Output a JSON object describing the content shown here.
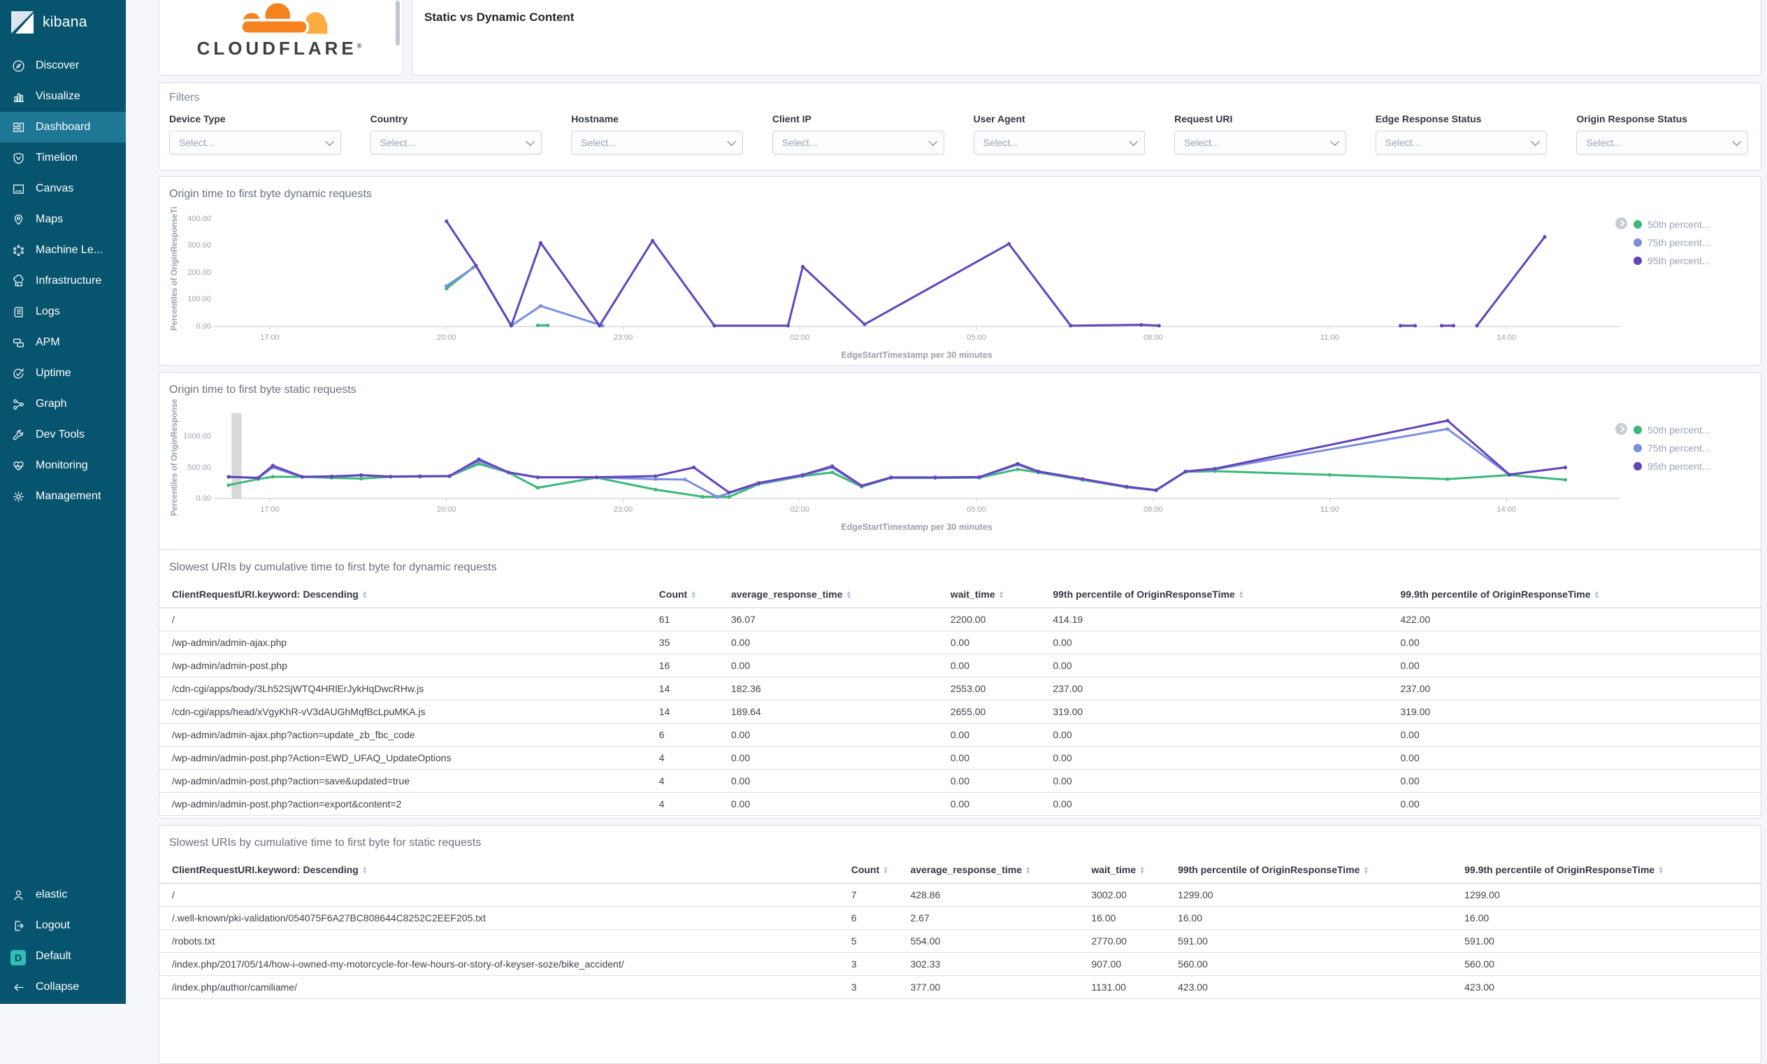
{
  "sidebar": {
    "logo_text": "kibana",
    "items": [
      {
        "icon": "discover",
        "label": "Discover",
        "active": false
      },
      {
        "icon": "visualize",
        "label": "Visualize",
        "active": false
      },
      {
        "icon": "dashboard",
        "label": "Dashboard",
        "active": true
      },
      {
        "icon": "timelion",
        "label": "Timelion",
        "active": false
      },
      {
        "icon": "canvas",
        "label": "Canvas",
        "active": false
      },
      {
        "icon": "maps",
        "label": "Maps",
        "active": false
      },
      {
        "icon": "machine-learning",
        "label": "Machine Le...",
        "active": false
      },
      {
        "icon": "infrastructure",
        "label": "Infrastructure",
        "active": false
      },
      {
        "icon": "logs",
        "label": "Logs",
        "active": false
      },
      {
        "icon": "apm",
        "label": "APM",
        "active": false
      },
      {
        "icon": "uptime",
        "label": "Uptime",
        "active": false
      },
      {
        "icon": "graph",
        "label": "Graph",
        "active": false
      },
      {
        "icon": "dev-tools",
        "label": "Dev Tools",
        "active": false
      },
      {
        "icon": "monitoring",
        "label": "Monitoring",
        "active": false
      },
      {
        "icon": "management",
        "label": "Management",
        "active": false
      }
    ],
    "footer_items": [
      {
        "icon": "user",
        "label": "elastic"
      },
      {
        "icon": "logout",
        "label": "Logout"
      },
      {
        "icon": "default-space",
        "label": "Default",
        "badge": "D"
      },
      {
        "icon": "collapse",
        "label": "Collapse"
      }
    ]
  },
  "header": {
    "dashboard_title": "Static vs Dynamic Content",
    "brand": "CLOUDFLARE"
  },
  "filters": {
    "panel_title": "Filters",
    "select_placeholder": "Select...",
    "fields": [
      "Device Type",
      "Country",
      "Hostname",
      "Client IP",
      "User Agent",
      "Request URI",
      "Edge Response Status",
      "Origin Response Status"
    ]
  },
  "chart_data": [
    {
      "type": "line",
      "title": "Origin time to first byte dynamic requests",
      "ylabel": "Percentiles of OriginResponseTi",
      "xlabel": "EdgeStartTimestamp per 30 minutes",
      "xlim": [
        16.05,
        39.92
      ],
      "ylim": [
        0,
        430
      ],
      "yticks": [
        0,
        100,
        200,
        300,
        400
      ],
      "ytick_labels": [
        "0.00",
        "100.00",
        "200.00",
        "300.00",
        "400.00"
      ],
      "xticks": [
        17,
        20,
        23,
        26,
        29,
        32,
        35,
        38
      ],
      "xtick_labels": [
        "17:00",
        "20:00",
        "23:00",
        "02:00",
        "05:00",
        "08:00",
        "11:00",
        "14:00"
      ],
      "legend_position": "right",
      "grid": false,
      "series": [
        {
          "name": "50th percent...",
          "color": "#3cb879",
          "segments": [
            [
              [
                20.0,
                140
              ],
              [
                20.45,
                218
              ]
            ],
            [
              [
                21.55,
                4
              ],
              [
                21.72,
                4
              ]
            ]
          ]
        },
        {
          "name": "75th percent...",
          "color": "#7b8fde",
          "segments": [
            [
              [
                20.0,
                150
              ],
              [
                20.5,
                224
              ],
              [
                21.1,
                3
              ],
              [
                21.6,
                76
              ],
              [
                22.65,
                3
              ]
            ]
          ]
        },
        {
          "name": "95th percent...",
          "color": "#6244bb",
          "segments": [
            [
              [
                20.0,
                390
              ],
              [
                20.5,
                226
              ],
              [
                21.1,
                3
              ],
              [
                21.6,
                310
              ],
              [
                22.6,
                3
              ],
              [
                23.5,
                318
              ],
              [
                24.55,
                3
              ],
              [
                25.8,
                3
              ],
              [
                26.05,
                222
              ],
              [
                27.1,
                8
              ],
              [
                29.55,
                306
              ],
              [
                30.6,
                3
              ],
              [
                31.8,
                6
              ],
              [
                32.1,
                3
              ]
            ],
            [
              [
                36.2,
                3
              ],
              [
                36.45,
                3
              ]
            ],
            [
              [
                36.9,
                3
              ],
              [
                37.1,
                3
              ]
            ],
            [
              [
                37.5,
                3
              ],
              [
                38.65,
                332
              ]
            ]
          ]
        }
      ]
    },
    {
      "type": "line",
      "title": "Origin time to first byte static requests",
      "ylabel": "Percentiles of OriginResponse",
      "xlabel": "EdgeStartTimestamp per 30 minutes",
      "xlim": [
        16.05,
        39.92
      ],
      "ylim": [
        0,
        1330
      ],
      "yticks": [
        0,
        500,
        1000
      ],
      "ytick_labels": [
        "0.00",
        "500.00",
        "1000.00"
      ],
      "xticks": [
        17,
        20,
        23,
        26,
        29,
        32,
        35,
        38
      ],
      "xtick_labels": [
        "17:00",
        "20:00",
        "23:00",
        "02:00",
        "05:00",
        "08:00",
        "11:00",
        "14:00"
      ],
      "legend_position": "right",
      "grid": false,
      "annotation_bar": {
        "t": 16.35,
        "width_hours": 0.17,
        "color": "#d8d8d8"
      },
      "series": [
        {
          "name": "50th percent...",
          "color": "#3cb879",
          "segments": [
            [
              [
                16.3,
                215
              ],
              [
                16.8,
                312
              ],
              [
                17.05,
                350
              ],
              [
                17.55,
                348
              ],
              [
                18.05,
                332
              ],
              [
                18.55,
                320
              ],
              [
                19.05,
                350
              ],
              [
                19.55,
                353
              ],
              [
                20.05,
                358
              ],
              [
                20.55,
                556
              ],
              [
                21.05,
                420
              ],
              [
                21.55,
                172
              ],
              [
                22.55,
                336
              ],
              [
                23.55,
                142
              ],
              [
                24.35,
                28
              ],
              [
                24.8,
                25
              ],
              [
                25.3,
                230
              ],
              [
                26.05,
                360
              ],
              [
                26.55,
                420
              ],
              [
                27.05,
                190
              ],
              [
                27.55,
                330
              ],
              [
                28.3,
                330
              ],
              [
                29.05,
                335
              ],
              [
                29.7,
                470
              ],
              [
                30.05,
                420
              ],
              [
                30.8,
                300
              ],
              [
                31.55,
                180
              ],
              [
                32.05,
                130
              ],
              [
                32.55,
                430
              ],
              [
                33.05,
                440
              ],
              [
                35.0,
                380
              ],
              [
                37.0,
                312
              ],
              [
                38.05,
                378
              ],
              [
                39.0,
                302
              ]
            ]
          ]
        },
        {
          "name": "75th percent...",
          "color": "#7b8fde",
          "segments": [
            [
              [
                16.3,
                345
              ],
              [
                16.8,
                330
              ],
              [
                17.05,
                500
              ],
              [
                17.55,
                346
              ],
              [
                18.05,
                352
              ],
              [
                18.55,
                372
              ],
              [
                19.05,
                352
              ],
              [
                19.55,
                357
              ],
              [
                20.05,
                360
              ],
              [
                20.55,
                600
              ],
              [
                21.05,
                418
              ],
              [
                21.55,
                338
              ],
              [
                22.55,
                338
              ],
              [
                23.55,
                312
              ],
              [
                24.05,
                305
              ],
              [
                24.6,
                25
              ],
              [
                25.3,
                240
              ],
              [
                26.05,
                370
              ],
              [
                26.55,
                500
              ],
              [
                27.05,
                200
              ],
              [
                27.55,
                335
              ],
              [
                28.3,
                335
              ],
              [
                29.05,
                340
              ],
              [
                29.7,
                545
              ],
              [
                30.05,
                430
              ],
              [
                30.8,
                310
              ],
              [
                31.55,
                185
              ],
              [
                32.05,
                132
              ],
              [
                32.55,
                432
              ],
              [
                33.05,
                470
              ],
              [
                37.0,
                1120
              ],
              [
                38.05,
                380
              ]
            ]
          ]
        },
        {
          "name": "95th percent...",
          "color": "#6244bb",
          "segments": [
            [
              [
                16.3,
                350
              ],
              [
                16.8,
                332
              ],
              [
                17.05,
                530
              ],
              [
                17.55,
                350
              ],
              [
                18.05,
                356
              ],
              [
                18.55,
                376
              ],
              [
                19.05,
                353
              ],
              [
                19.55,
                358
              ],
              [
                20.05,
                362
              ],
              [
                20.55,
                632
              ],
              [
                21.05,
                422
              ],
              [
                21.55,
                342
              ],
              [
                22.55,
                342
              ],
              [
                23.55,
                360
              ],
              [
                24.2,
                500
              ],
              [
                24.8,
                95
              ],
              [
                25.3,
                250
              ],
              [
                26.05,
                380
              ],
              [
                26.55,
                520
              ],
              [
                27.05,
                205
              ],
              [
                27.55,
                340
              ],
              [
                28.3,
                340
              ],
              [
                29.05,
                345
              ],
              [
                29.7,
                560
              ],
              [
                30.05,
                435
              ],
              [
                30.8,
                315
              ],
              [
                31.55,
                190
              ],
              [
                32.05,
                135
              ],
              [
                32.55,
                435
              ],
              [
                33.05,
                480
              ],
              [
                37.0,
                1255
              ],
              [
                38.05,
                385
              ],
              [
                39.0,
                500
              ]
            ]
          ]
        }
      ]
    }
  ],
  "tables": [
    {
      "panel_title": "Slowest URIs by cumulative time to first byte for dynamic requests",
      "columns": [
        "ClientRequestURI.keyword: Descending",
        "Count",
        "average_response_time",
        "wait_time",
        "99th percentile of OriginResponseTime",
        "99.9th percentile of OriginResponseTime"
      ],
      "rows": [
        [
          "/",
          "61",
          "36.07",
          "2200.00",
          "414.19",
          "422.00"
        ],
        [
          "/wp-admin/admin-ajax.php",
          "35",
          "0.00",
          "0.00",
          "0.00",
          "0.00"
        ],
        [
          "/wp-admin/admin-post.php",
          "16",
          "0.00",
          "0.00",
          "0.00",
          "0.00"
        ],
        [
          "/cdn-cgi/apps/body/3Lh52SjWTQ4HRlErJykHqDwcRHw.js",
          "14",
          "182.36",
          "2553.00",
          "237.00",
          "237.00"
        ],
        [
          "/cdn-cgi/apps/head/xVgyKhR-vV3dAUGhMqfBcLpuMKA.js",
          "14",
          "189.64",
          "2655.00",
          "319.00",
          "319.00"
        ],
        [
          "/wp-admin/admin-ajax.php?action=update_zb_fbc_code",
          "6",
          "0.00",
          "0.00",
          "0.00",
          "0.00"
        ],
        [
          "/wp-admin/admin-post.php?Action=EWD_UFAQ_UpdateOptions",
          "4",
          "0.00",
          "0.00",
          "0.00",
          "0.00"
        ],
        [
          "/wp-admin/admin-post.php?action=save&updated=true",
          "4",
          "0.00",
          "0.00",
          "0.00",
          "0.00"
        ],
        [
          "/wp-admin/admin-post.php?action=export&content=2",
          "4",
          "0.00",
          "0.00",
          "0.00",
          "0.00"
        ]
      ]
    },
    {
      "panel_title": "Slowest URIs by cumulative time to first byte for static requests",
      "columns": [
        "ClientRequestURI.keyword: Descending",
        "Count",
        "average_response_time",
        "wait_time",
        "99th percentile of OriginResponseTime",
        "99.9th percentile of OriginResponseTime"
      ],
      "rows": [
        [
          "/",
          "7",
          "428.86",
          "3002.00",
          "1299.00",
          "1299.00"
        ],
        [
          "/.well-known/pki-validation/054075F6A27BC808644C8252C2EEF205.txt",
          "6",
          "2.67",
          "16.00",
          "16.00",
          "16.00"
        ],
        [
          "/robots.txt",
          "5",
          "554.00",
          "2770.00",
          "591.00",
          "591.00"
        ],
        [
          "/index.php/2017/05/14/how-i-owned-my-motorcycle-for-few-hours-or-story-of-keyser-soze/bike_accident/",
          "3",
          "302.33",
          "907.00",
          "560.00",
          "560.00"
        ],
        [
          "/index.php/author/camiliame/",
          "3",
          "377.00",
          "1131.00",
          "423.00",
          "423.00"
        ]
      ]
    }
  ]
}
